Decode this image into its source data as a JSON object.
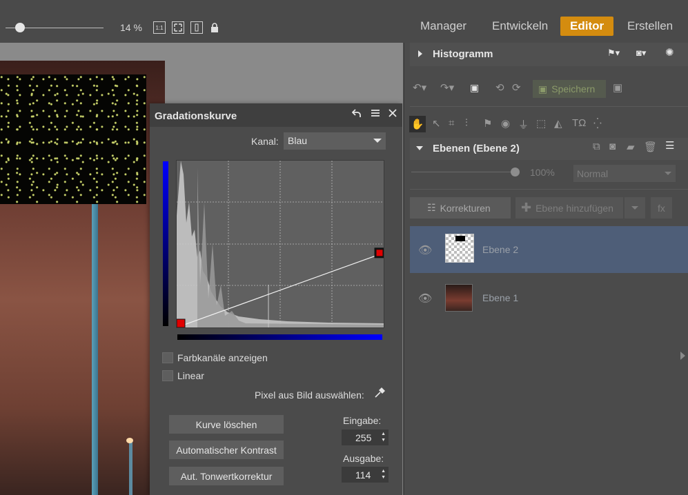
{
  "topbar": {
    "zoom_value": "14 %",
    "icons": [
      "fit-1-1-icon",
      "fit-screen-icon",
      "fit-width-icon",
      "lock-icon"
    ],
    "fit_1_1_label": "1:1",
    "mode_tabs": [
      {
        "label": "Manager",
        "active": false
      },
      {
        "label": "Entwickeln",
        "active": false
      },
      {
        "label": "Editor",
        "active": true
      },
      {
        "label": "Erstellen",
        "active": false
      }
    ],
    "accent_color": "#d48c0f"
  },
  "curve_dialog": {
    "title": "Gradationskurve",
    "channel_label": "Kanal:",
    "channel_value": "Blau",
    "show_channels_label": "Farbkanäle anzeigen",
    "linear_label": "Linear",
    "pick_pixel_label": "Pixel aus Bild auswählen:",
    "buttons": {
      "clear_curve": "Kurve löschen",
      "auto_contrast": "Automatischer Kontrast",
      "auto_levels": "Aut. Tonwertkorrektur"
    },
    "input_label": "Eingabe:",
    "input_value": "255",
    "output_label": "Ausgabe:",
    "output_value": "114",
    "curve_points": [
      {
        "input": 0,
        "output": 0
      },
      {
        "input": 255,
        "output": 114
      }
    ],
    "point_color": "#e00000"
  },
  "right_panel": {
    "histogram_title": "Histogramm",
    "save_label": "Speichern",
    "layers_title": "Ebenen (Ebene 2)",
    "opacity_value": "100%",
    "blend_mode": "Normal",
    "corrections_label": "Korrekturen",
    "add_layer_label": "Ebene hinzufügen",
    "fx_label": "fx",
    "layers": [
      {
        "name": "Ebene 2",
        "selected": true
      },
      {
        "name": "Ebene 1",
        "selected": false
      }
    ],
    "selected_row_color": "#4e5e78"
  }
}
